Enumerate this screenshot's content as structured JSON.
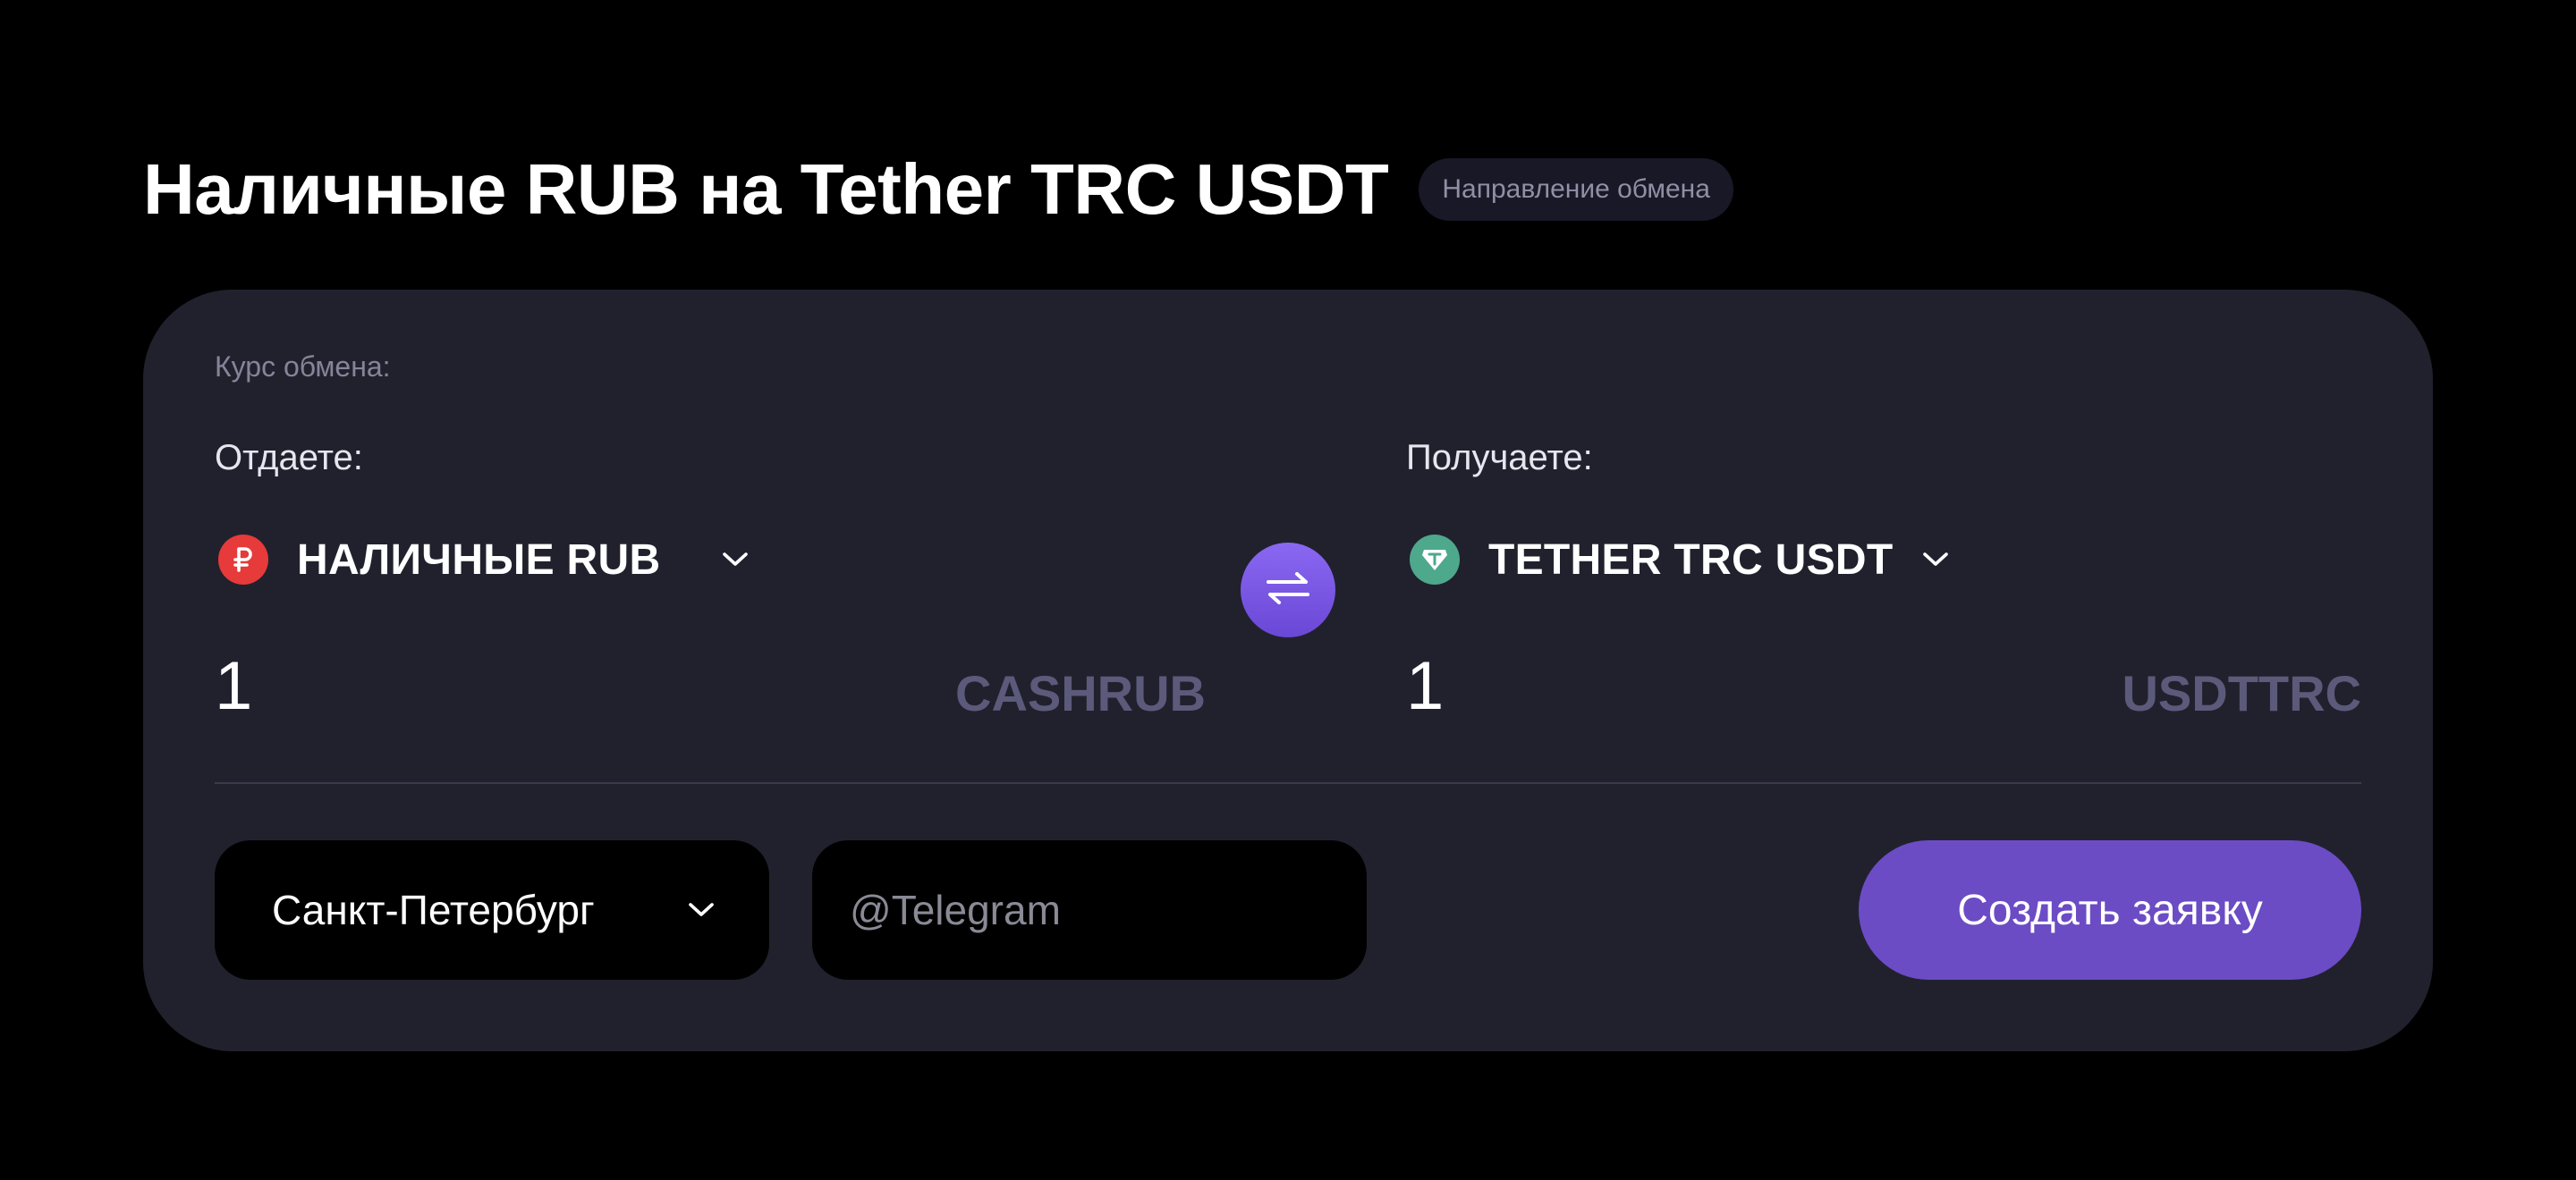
{
  "page": {
    "title": "Наличные RUB на Tether TRC USDT",
    "badge": "Направление обмена"
  },
  "exchange": {
    "rate_label": "Курс обмена:",
    "give": {
      "label": "Отдаете:",
      "currency_name": "НАЛИЧНЫЕ RUB",
      "currency_icon": "ruble-coin-icon",
      "amount": "1",
      "code": "CASHRUB"
    },
    "receive": {
      "label": "Получаете:",
      "currency_name": "TETHER TRC USDT",
      "currency_icon": "tether-coin-icon",
      "amount": "1",
      "code": "USDTTRC"
    },
    "swap_icon": "swap-arrows-icon"
  },
  "form": {
    "city": "Санкт-Петербург",
    "telegram_placeholder": "@Telegram",
    "submit_label": "Создать заявку"
  },
  "colors": {
    "background": "#000000",
    "card": "#21212e",
    "accent": "#6b4cc4",
    "code_text": "#5c5a7a",
    "ruble_coin": "#e73a3a",
    "tether_coin": "#4ea88c"
  }
}
